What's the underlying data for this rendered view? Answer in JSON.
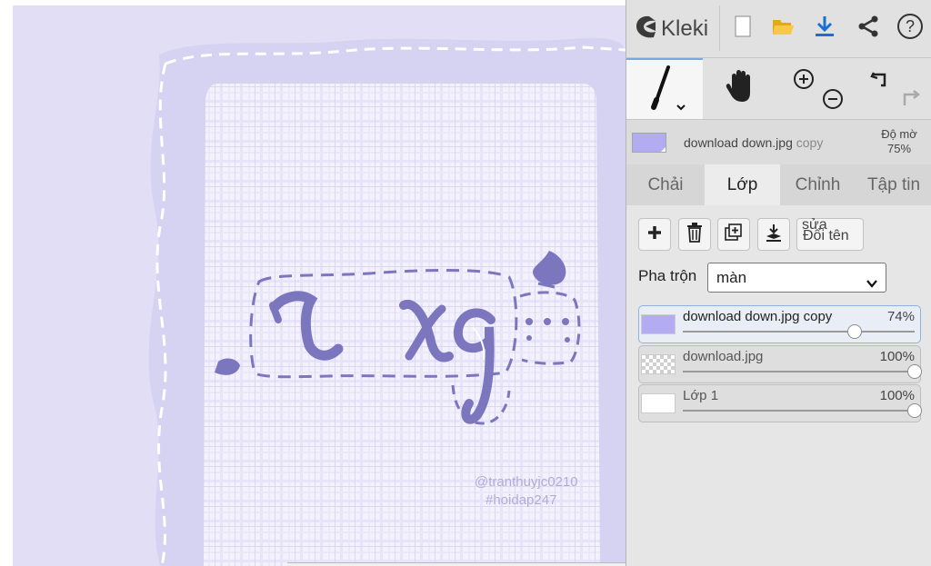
{
  "app": {
    "name": "Kleki",
    "toolbar_icons": [
      "kleki-logo-icon",
      "new-image-icon",
      "open-folder-icon",
      "download-icon",
      "share-icon",
      "help-icon"
    ]
  },
  "canvas": {
    "background_color": "#e3e0f7",
    "frame_color": "#d8d5f4",
    "lettering_color": "#7c76bf",
    "watermark_lines": [
      "@tranthuyjc0210",
      "#hoidap247"
    ]
  },
  "tools": {
    "items": [
      "brush-tool-icon",
      "hand-tool-icon",
      "zoom-in-icon",
      "zoom-out-icon",
      "undo-icon",
      "redo-icon"
    ]
  },
  "current_layer": {
    "name": "download down.jpg",
    "name_suffix": "copy",
    "color": "#b3acf1",
    "opacity_label": "Độ mờ",
    "opacity_value": "75%"
  },
  "tabs": [
    {
      "label": "Chải",
      "active": false
    },
    {
      "label": "Lớp",
      "active": true
    },
    {
      "label": "Chỉnh",
      "active": false
    },
    {
      "label": "Tập tin",
      "active": false
    }
  ],
  "layer_actions": {
    "icons": [
      "add-layer-icon",
      "delete-layer-icon",
      "duplicate-layer-icon",
      "merge-down-icon"
    ],
    "rename_label": "Đổi tên",
    "rename_overlap": "sửa"
  },
  "blend": {
    "label": "Pha trộn",
    "value": "màn"
  },
  "layers": [
    {
      "name": "download down.jpg copy",
      "opacity": "74%",
      "fraction": 0.74,
      "thumb": "lavender",
      "selected": true
    },
    {
      "name": "download.jpg",
      "opacity": "100%",
      "fraction": 1.0,
      "thumb": "checker",
      "selected": false
    },
    {
      "name": "Lớp 1",
      "opacity": "100%",
      "fraction": 1.0,
      "thumb": "white",
      "selected": false
    }
  ]
}
